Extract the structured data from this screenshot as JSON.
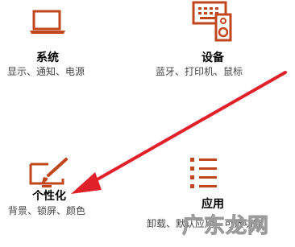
{
  "accent_color": "#c0461c",
  "tiles": {
    "system": {
      "icon": "laptop-icon",
      "title": "系统",
      "desc": "显示、通知、电源"
    },
    "devices": {
      "icon": "keyboard-speaker-icon",
      "title": "设备",
      "desc": "蓝牙、打印机、鼠标"
    },
    "personalization": {
      "icon": "paint-brush-monitor-icon",
      "title": "个性化",
      "desc": "背景、锁屏、颜色"
    },
    "apps": {
      "icon": "app-list-icon",
      "title": "应用",
      "desc": "卸载、默认应用、可选功能"
    }
  },
  "annotation": {
    "arrow_color": "#e0212a"
  },
  "watermark": {
    "text": "广东龙网"
  }
}
